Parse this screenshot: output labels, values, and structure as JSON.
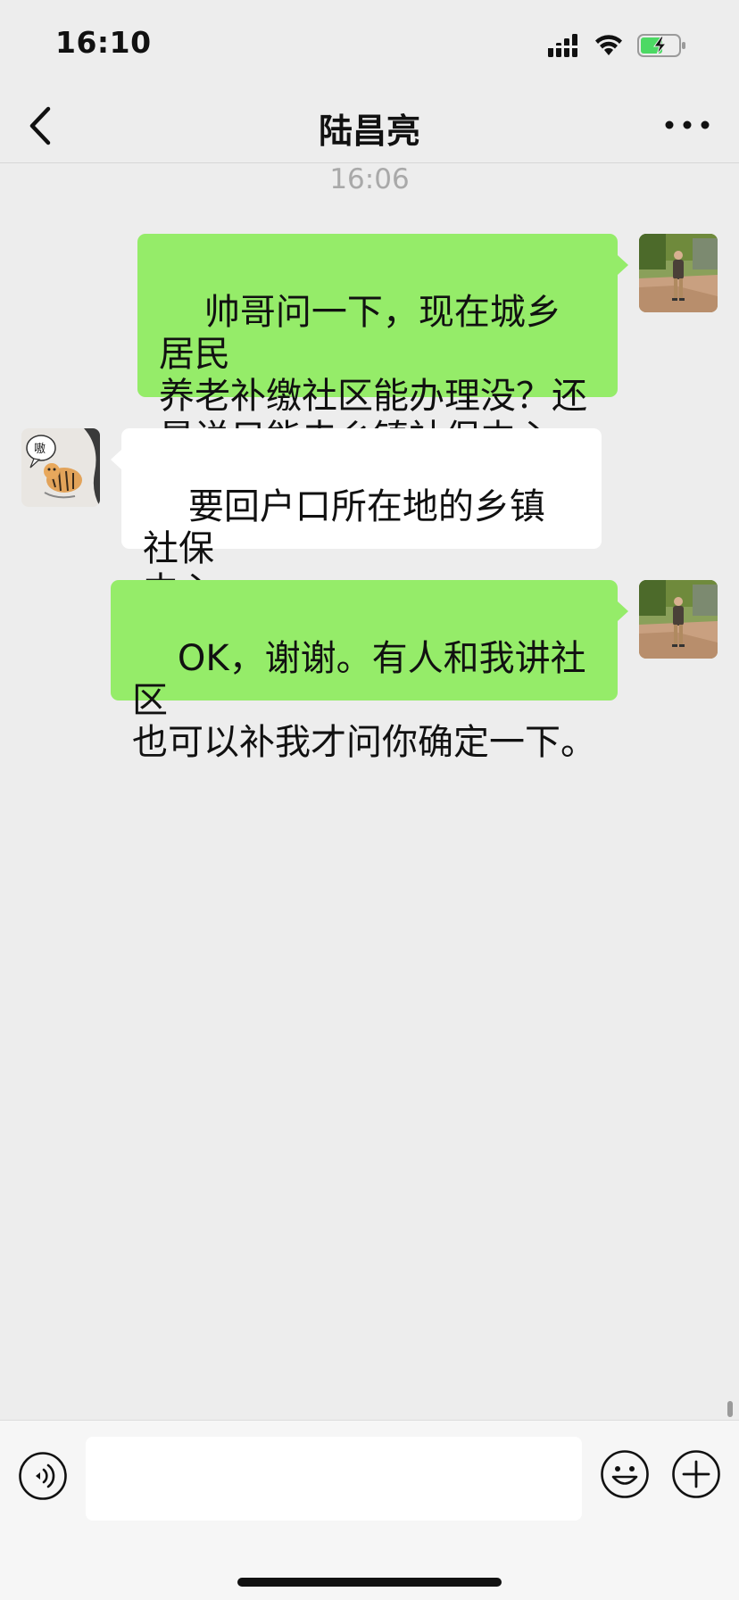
{
  "status_bar": {
    "time": "16:10",
    "signal_icon": "cellular-signal-icon",
    "wifi_icon": "wifi-icon",
    "battery_icon": "battery-charging-icon",
    "battery_color": "#4cd964"
  },
  "nav": {
    "title": "陆昌亮",
    "back_icon": "chevron-left-icon",
    "more_icon": "more-dots-icon"
  },
  "chat": {
    "timestamp": "16:06",
    "messages": [
      {
        "direction": "out",
        "text": "帅哥问一下，现在城乡居民\n养老补缴社区能办理没？还\n是说只能去乡镇社保中心。"
      },
      {
        "direction": "in",
        "text": "要回户口所在地的乡镇社保\n中心"
      },
      {
        "direction": "out",
        "text": "OK，谢谢。有人和我讲社区\n也可以补我才问你确定一下。"
      }
    ]
  },
  "input_bar": {
    "voice_icon": "voice-icon",
    "input_value": "",
    "emoji_icon": "emoji-icon",
    "plus_icon": "plus-icon"
  },
  "colors": {
    "outgoing_bubble": "#95ec69",
    "incoming_bubble": "#ffffff",
    "background": "#ededed"
  }
}
